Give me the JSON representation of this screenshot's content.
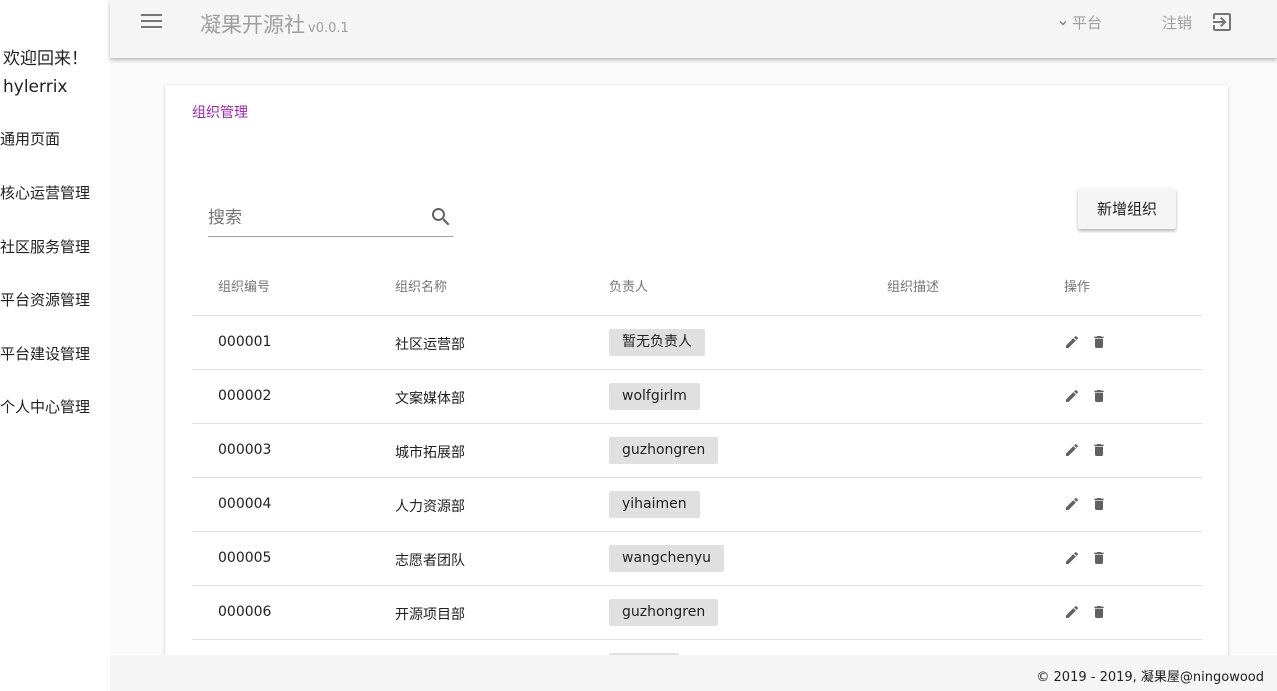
{
  "sidebar": {
    "welcome": "欢迎回来！",
    "username": "hylerrix",
    "items": [
      {
        "label": "通用页面"
      },
      {
        "label": "核心运营管理"
      },
      {
        "label": "社区服务管理"
      },
      {
        "label": "平台资源管理"
      },
      {
        "label": "平台建设管理"
      },
      {
        "label": "个人中心管理"
      }
    ]
  },
  "header": {
    "menu_icon": "menu-icon",
    "title": "凝果开源社",
    "version": "v0.0.1",
    "platform_label": "平台",
    "logout_label": "注销",
    "logout_icon": "exit-to-app-icon"
  },
  "main": {
    "breadcrumb": "组织管理",
    "search_placeholder": "搜索",
    "add_button": "新增组织",
    "columns": [
      "组织编号",
      "组织名称",
      "负责人",
      "组织描述",
      "操作"
    ],
    "rows": [
      {
        "id": "000001",
        "name": "社区运营部",
        "owner": "暂无负责人",
        "desc": ""
      },
      {
        "id": "000002",
        "name": "文案媒体部",
        "owner": "wolfgirlm",
        "desc": ""
      },
      {
        "id": "000003",
        "name": "城市拓展部",
        "owner": "guzhongren",
        "desc": ""
      },
      {
        "id": "000004",
        "name": "人力资源部",
        "owner": "yihaimen",
        "desc": ""
      },
      {
        "id": "000005",
        "name": "志愿者团队",
        "owner": "wangchenyu",
        "desc": ""
      },
      {
        "id": "000006",
        "name": "开源项目部",
        "owner": "guzhongren",
        "desc": ""
      }
    ]
  },
  "footer": {
    "copyright": "© 2019 - 2019, 凝果屋@ningowood"
  },
  "colors": {
    "accent": "#9c27b0",
    "topbar": "#f5f5f5",
    "chip": "#e0e0e0",
    "muted": "#9e9e9e"
  }
}
